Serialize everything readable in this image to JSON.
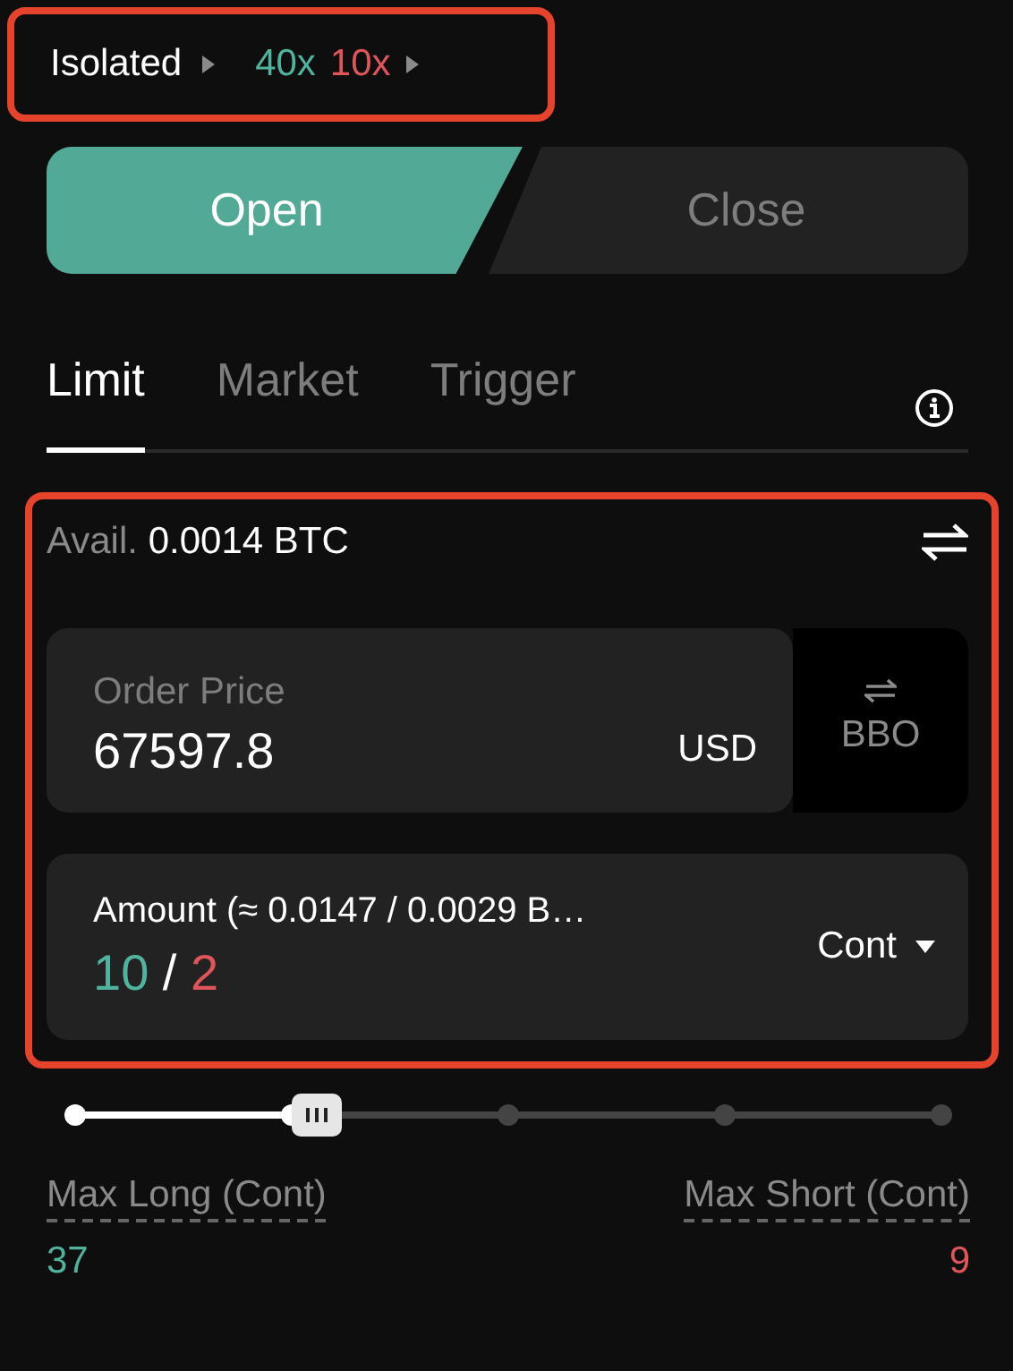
{
  "header": {
    "margin_mode": "Isolated",
    "leverage": [
      {
        "label": "40x",
        "color": "#4fb39d"
      },
      {
        "label": "10x",
        "color": "#e0555a"
      }
    ]
  },
  "actions": [
    {
      "label": "Open",
      "selected": true
    },
    {
      "label": "Close",
      "selected": false
    }
  ],
  "order_types": [
    {
      "label": "Limit",
      "selected": true
    },
    {
      "label": "Market",
      "selected": false
    },
    {
      "label": "Trigger",
      "selected": false
    }
  ],
  "available": {
    "label": "Avail.",
    "value": "0.0014 BTC"
  },
  "price_field": {
    "label": "Order Price",
    "value": "67597.8",
    "unit": "USD"
  },
  "bbo_button": {
    "label": "BBO"
  },
  "amount_field": {
    "label": "Amount (≈ 0.0147 / 0.0029 B…",
    "long_value": "10",
    "separator": "/",
    "short_value": "2",
    "unit": "Cont"
  },
  "slider": {
    "level": 0.25
  },
  "max_long": {
    "label": "Max Long (Cont)",
    "value": "37"
  },
  "max_short": {
    "label": "Max Short (Cont)",
    "value": "9"
  }
}
